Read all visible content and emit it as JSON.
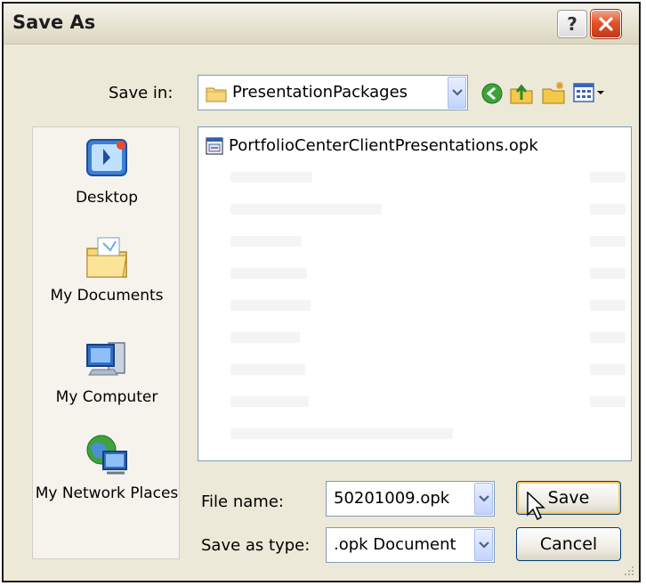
{
  "window": {
    "title": "Save As"
  },
  "title_buttons": {
    "help": "?"
  },
  "toolbar": {
    "save_in_label": "Save in:",
    "save_in_value": "PresentationPackages"
  },
  "places": [
    {
      "label": "Desktop"
    },
    {
      "label": "My Documents"
    },
    {
      "label": "My Computer"
    },
    {
      "label": "My Network Places"
    }
  ],
  "files": [
    {
      "name": "PortfolioCenterClientPresentations.opk"
    }
  ],
  "form": {
    "file_name_label": "File name:",
    "file_name_value": "50201009.opk",
    "save_type_label": "Save as type:",
    "save_type_value": ".opk Document"
  },
  "buttons": {
    "save": "Save",
    "cancel": "Cancel"
  },
  "icons": {
    "folder": "folder-icon",
    "back": "back-icon",
    "up": "up-folder-icon",
    "new_folder": "new-folder-icon",
    "views": "views-menu-icon"
  },
  "colors": {
    "dialog_bg": "#ECE9D8",
    "close_red": "#E2542A",
    "accent_border": "#7F9DB9"
  }
}
